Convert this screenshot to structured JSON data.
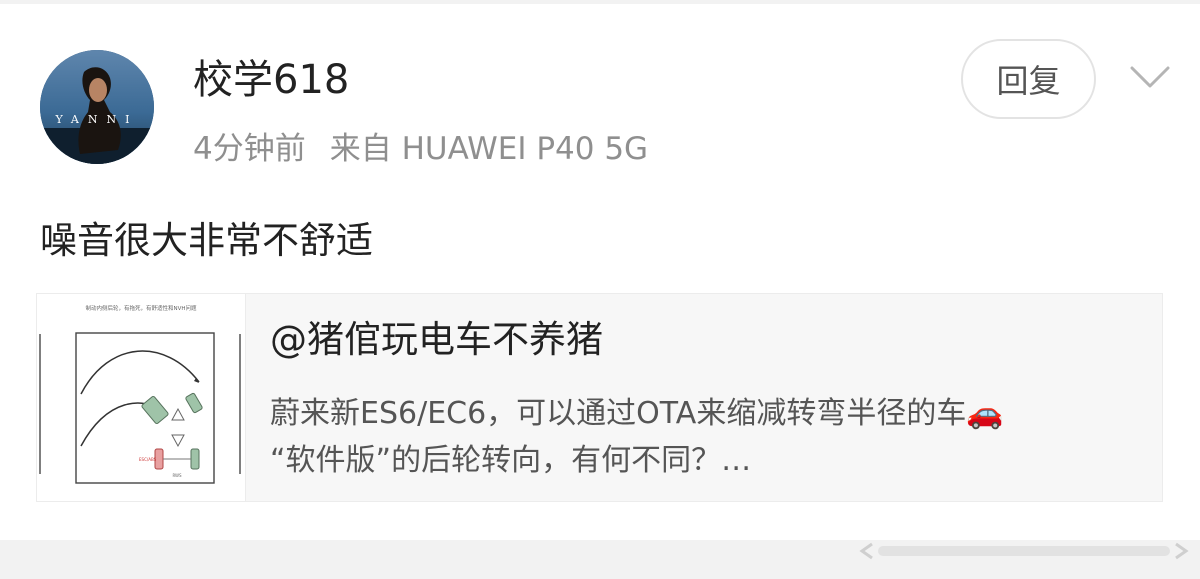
{
  "post": {
    "username": "校学618",
    "time": "4分钟前",
    "source": "来自 HUAWEI P40 5G",
    "reply_label": "回复",
    "text": "噪音很大非常不舒适",
    "avatar_text": "YANNI"
  },
  "repost": {
    "author": "@猪倌玩电车不养猪",
    "line1": "蔚来新ES6/EC6，可以通过OTA来缩减转弯半径的车🚗",
    "line2": "“软件版”的后轮转向，有何不同？…",
    "thumb_caption": "制动内侧后轮，有拖死，有舒适性和NVH问题"
  },
  "icons": {
    "more": "chevron-down-icon"
  },
  "colors": {
    "text_primary": "#222222",
    "text_meta": "#8f8f8f",
    "card_bg": "#f7f7f7",
    "button_border": "#e3e3e3"
  }
}
